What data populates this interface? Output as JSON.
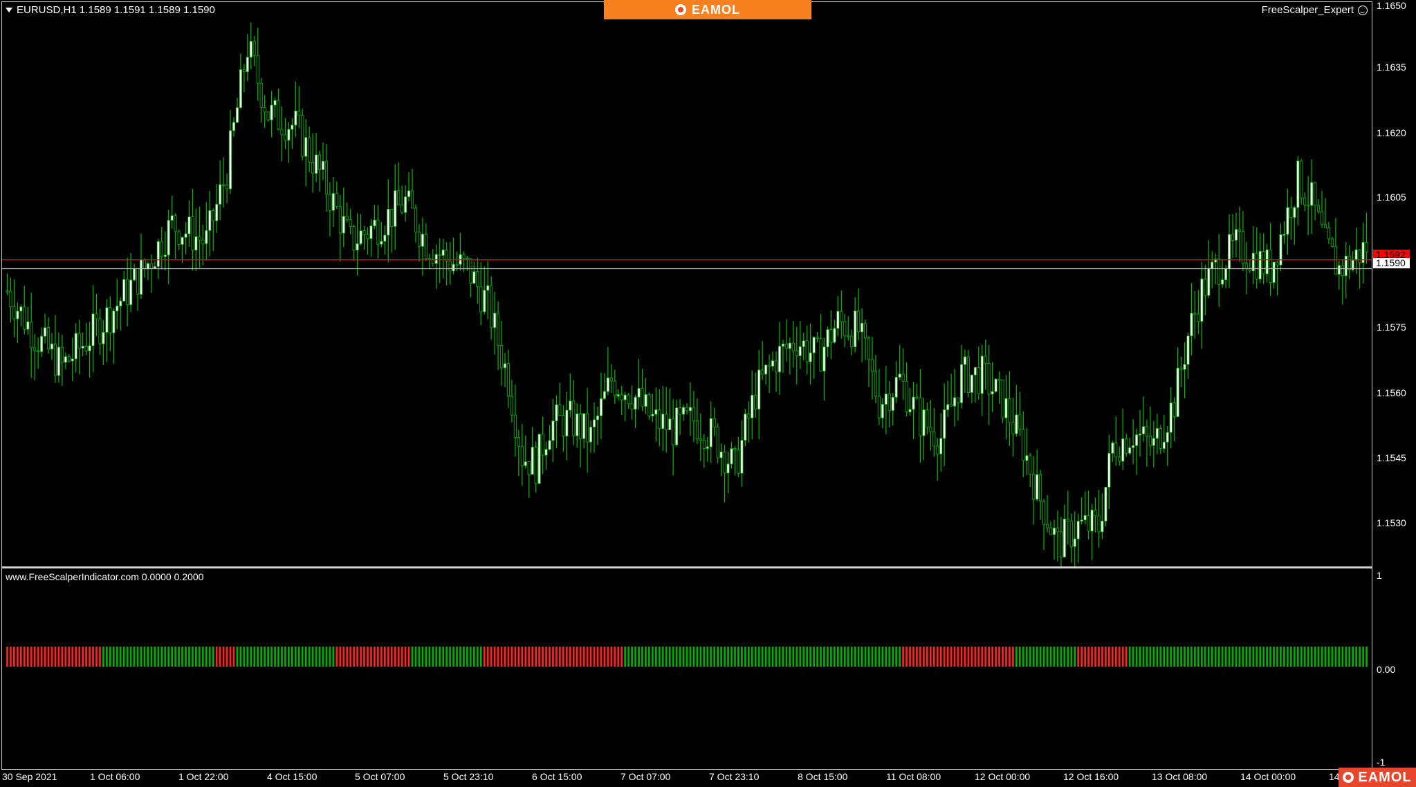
{
  "window": {
    "symbol_header": "EURUSD,H1  1.1589 1.1591 1.1589 1.1590",
    "expert_label": "FreeScalper_Expert",
    "brand_top": "EAMOL",
    "brand_bottom": "EAMOL"
  },
  "price_axis": {
    "labels": [
      "1.1650",
      "1.1635",
      "1.1620",
      "1.1605",
      "1.1575",
      "1.1560",
      "1.1545",
      "1.1530"
    ],
    "bid_tag": "1.1590",
    "ask_tag": "1.1592"
  },
  "indicator": {
    "label": "www.FreeScalperIndicator.com  0.0000 0.2000",
    "axis_labels": [
      "1",
      "0.00",
      "-1"
    ]
  },
  "time_axis": {
    "labels": [
      "30 Sep 2021",
      "1 Oct 06:00",
      "1 Oct 22:00",
      "4 Oct 15:00",
      "5 Oct 07:00",
      "5 Oct 23:10",
      "6 Oct 15:00",
      "7 Oct 07:00",
      "7 Oct 23:10",
      "8 Oct 15:00",
      "11 Oct 08:00",
      "12 Oct 00:00",
      "12 Oct 16:00",
      "13 Oct 08:00",
      "14 Oct 00:00",
      "14"
    ]
  },
  "colors": {
    "bull_candle": "#ffffff",
    "bear_candle": "#000000",
    "wick": "#00c000",
    "ask_line": "#ff0000",
    "bid_line": "#c0c0c0",
    "histo_up": "#00b000",
    "histo_down": "#ff2020",
    "brand_orange": "#f7811e",
    "brand_red": "#e8462b"
  },
  "chart_data": {
    "type": "candlestick",
    "symbol": "EURUSD",
    "timeframe": "H1",
    "ylim": [
      1.1523,
      1.165
    ],
    "ask_line": 1.1592,
    "bid_line": 1.159,
    "close_path": [
      [
        0,
        1.1585
      ],
      [
        8,
        1.1575
      ],
      [
        16,
        1.1568
      ],
      [
        22,
        1.1573
      ],
      [
        30,
        1.158
      ],
      [
        40,
        1.159
      ],
      [
        48,
        1.16
      ],
      [
        58,
        1.1596
      ],
      [
        64,
        1.1612
      ],
      [
        70,
        1.164
      ],
      [
        76,
        1.1625
      ],
      [
        84,
        1.1622
      ],
      [
        92,
        1.161
      ],
      [
        100,
        1.1596
      ],
      [
        108,
        1.16
      ],
      [
        116,
        1.1605
      ],
      [
        122,
        1.1596
      ],
      [
        128,
        1.1592
      ],
      [
        134,
        1.159
      ],
      [
        140,
        1.1582
      ],
      [
        146,
        1.1565
      ],
      [
        150,
        1.1548
      ],
      [
        154,
        1.1546
      ],
      [
        158,
        1.1555
      ],
      [
        164,
        1.1556
      ],
      [
        170,
        1.1552
      ],
      [
        176,
        1.1565
      ],
      [
        182,
        1.1562
      ],
      [
        188,
        1.1556
      ],
      [
        194,
        1.1554
      ],
      [
        200,
        1.1556
      ],
      [
        206,
        1.1552
      ],
      [
        212,
        1.1545
      ],
      [
        218,
        1.1562
      ],
      [
        224,
        1.157
      ],
      [
        230,
        1.1574
      ],
      [
        236,
        1.157
      ],
      [
        242,
        1.1578
      ],
      [
        248,
        1.1576
      ],
      [
        254,
        1.156
      ],
      [
        260,
        1.1565
      ],
      [
        266,
        1.1556
      ],
      [
        272,
        1.1552
      ],
      [
        278,
        1.1566
      ],
      [
        284,
        1.1566
      ],
      [
        290,
        1.156
      ],
      [
        296,
        1.155
      ],
      [
        300,
        1.154
      ],
      [
        306,
        1.1528
      ],
      [
        312,
        1.1532
      ],
      [
        318,
        1.1532
      ],
      [
        322,
        1.155
      ],
      [
        328,
        1.1553
      ],
      [
        334,
        1.155
      ],
      [
        340,
        1.156
      ],
      [
        344,
        1.1575
      ],
      [
        348,
        1.1585
      ],
      [
        352,
        1.159
      ],
      [
        358,
        1.1595
      ],
      [
        364,
        1.1592
      ],
      [
        368,
        1.159
      ],
      [
        372,
        1.16
      ],
      [
        376,
        1.161
      ],
      [
        380,
        1.1605
      ],
      [
        384,
        1.1595
      ],
      [
        388,
        1.159
      ],
      [
        392,
        1.1592
      ],
      [
        396,
        1.1595
      ]
    ],
    "indicator_segments": [
      {
        "from": 0,
        "to": 27,
        "signal": "down"
      },
      {
        "from": 28,
        "to": 60,
        "signal": "up"
      },
      {
        "from": 61,
        "to": 66,
        "signal": "down"
      },
      {
        "from": 67,
        "to": 95,
        "signal": "up"
      },
      {
        "from": 96,
        "to": 117,
        "signal": "down"
      },
      {
        "from": 118,
        "to": 138,
        "signal": "up"
      },
      {
        "from": 139,
        "to": 179,
        "signal": "down"
      },
      {
        "from": 180,
        "to": 222,
        "signal": "up"
      },
      {
        "from": 223,
        "to": 260,
        "signal": "up"
      },
      {
        "from": 261,
        "to": 293,
        "signal": "down"
      },
      {
        "from": 294,
        "to": 311,
        "signal": "up"
      },
      {
        "from": 312,
        "to": 326,
        "signal": "down"
      },
      {
        "from": 327,
        "to": 396,
        "signal": "up"
      }
    ]
  }
}
